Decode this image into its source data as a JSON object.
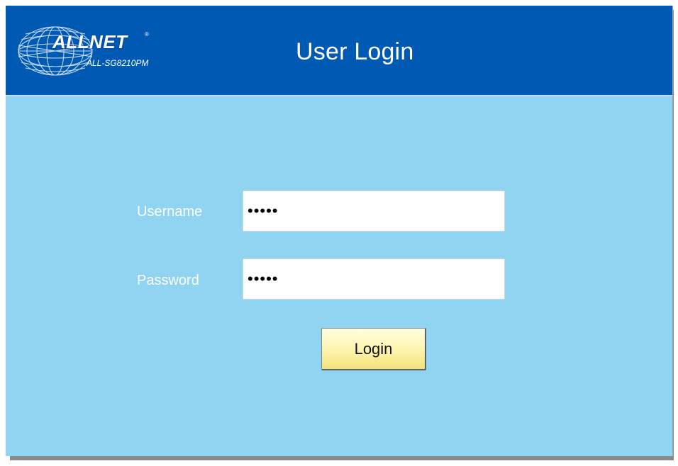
{
  "header": {
    "brand": "ALLNET",
    "registered_mark": "®",
    "model": "ALL-SG8210PM",
    "title": "User Login",
    "background_color": "#0059b3"
  },
  "form": {
    "background_color": "#90d4f2",
    "username_label": "Username",
    "username_value": "admin",
    "password_label": "Password",
    "password_value": "admin",
    "login_button_label": "Login"
  },
  "icons": {
    "logo": "globe-logo-icon"
  }
}
